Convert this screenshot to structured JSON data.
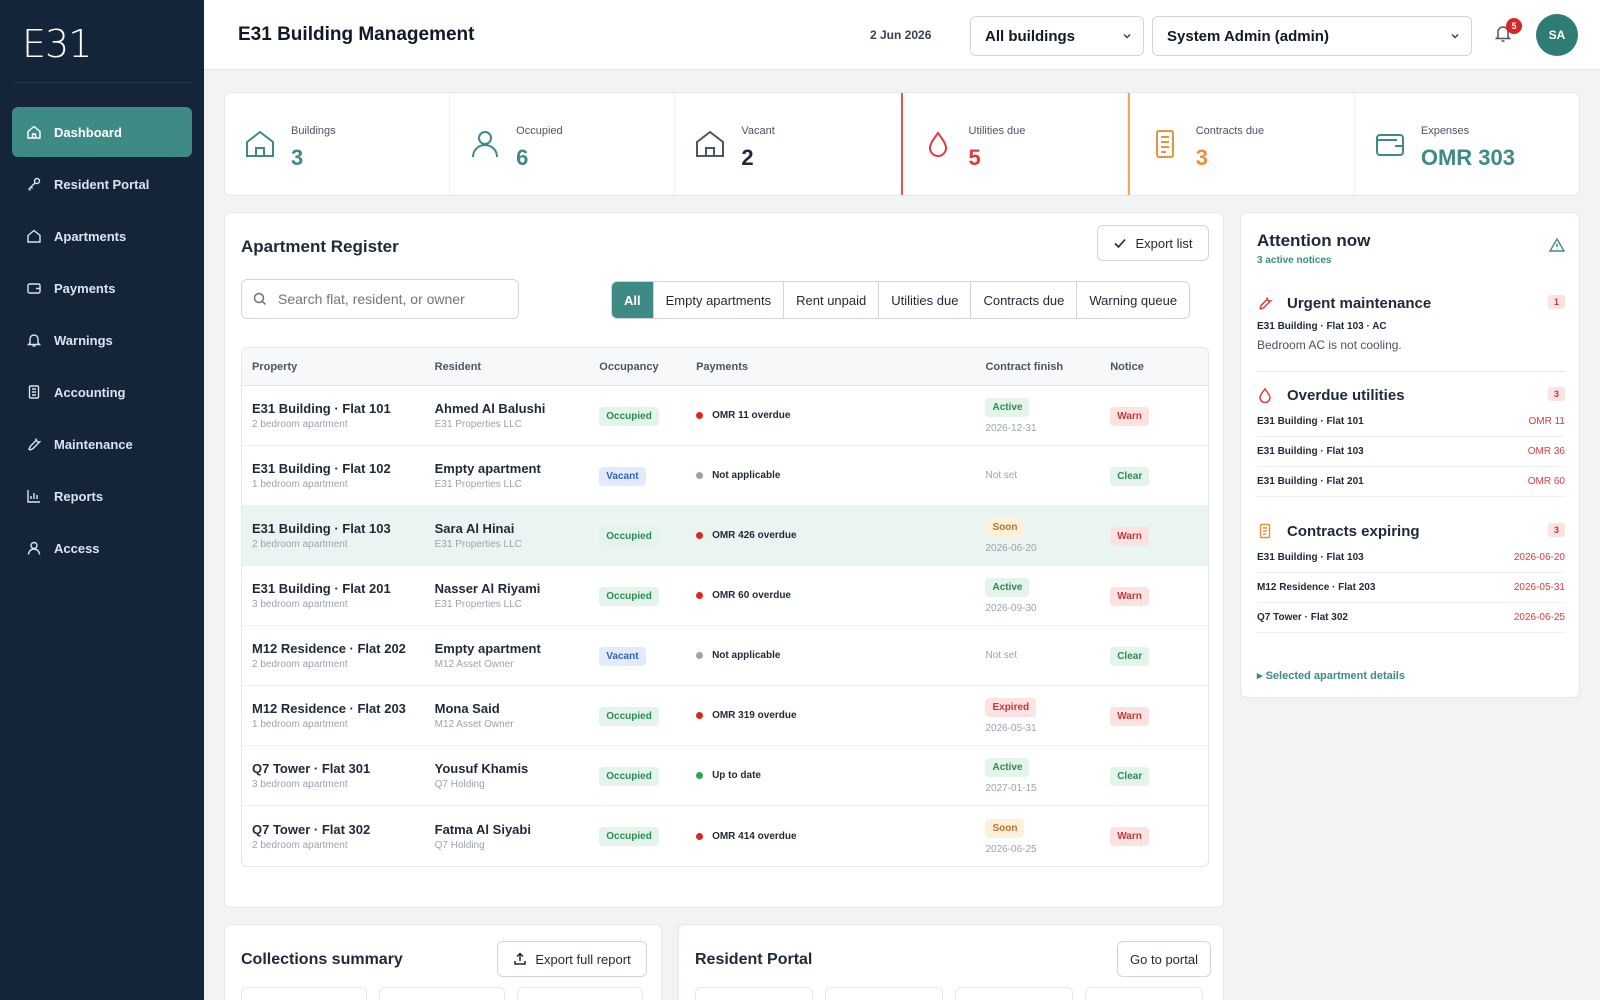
{
  "sidebar": {
    "logo": "E31",
    "items": [
      {
        "label": "Dashboard",
        "icon": "home-icon",
        "active": true
      },
      {
        "label": "Resident Portal",
        "icon": "key-icon"
      },
      {
        "label": "Apartments",
        "icon": "house-icon"
      },
      {
        "label": "Payments",
        "icon": "wallet-icon"
      },
      {
        "label": "Warnings",
        "icon": "bell-icon"
      },
      {
        "label": "Accounting",
        "icon": "ledger-icon"
      },
      {
        "label": "Maintenance",
        "icon": "wrench-icon"
      },
      {
        "label": "Reports",
        "icon": "bar-chart-icon"
      },
      {
        "label": "Access",
        "icon": "user-icon"
      }
    ]
  },
  "header": {
    "title": "E31 Building Management",
    "date": "2 Jun 2026",
    "building_select": "All buildings",
    "user_select": "System Admin (admin)",
    "notification_count": "5",
    "avatar_initials": "SA"
  },
  "stats": [
    {
      "label": "Buildings",
      "value": "3"
    },
    {
      "label": "Occupied",
      "value": "6"
    },
    {
      "label": "Vacant",
      "value": "2"
    },
    {
      "label": "Utilities due",
      "value": "5"
    },
    {
      "label": "Contracts due",
      "value": "3"
    },
    {
      "label": "Expenses",
      "value": "OMR 303"
    }
  ],
  "register": {
    "title": "Apartment Register",
    "export_label": "Export list",
    "search_placeholder": "Search flat, resident, or owner",
    "filters": [
      "All",
      "Empty apartments",
      "Rent unpaid",
      "Utilities due",
      "Contracts due",
      "Warning queue"
    ],
    "columns": [
      "Property",
      "Resident",
      "Occupancy",
      "Payments",
      "Contract finish",
      "Notice"
    ],
    "rows": [
      {
        "property": "E31 Building · Flat 101",
        "type": "2 bedroom apartment",
        "resident": "Ahmed Al Balushi",
        "owner": "E31 Properties LLC",
        "occupancy": "Occupied",
        "payment": "OMR 11 overdue",
        "pay_status": "red",
        "contract": "Active",
        "contract_date": "2026-12-31",
        "notice": "Warn"
      },
      {
        "property": "E31 Building · Flat 102",
        "type": "1 bedroom apartment",
        "resident": "Empty apartment",
        "owner": "E31 Properties LLC",
        "occupancy": "Vacant",
        "payment": "Not applicable",
        "pay_status": "grey",
        "contract": "",
        "contract_date": "Not set",
        "notice": "Clear"
      },
      {
        "property": "E31 Building · Flat 103",
        "type": "2 bedroom apartment",
        "resident": "Sara Al Hinai",
        "owner": "E31 Properties LLC",
        "occupancy": "Occupied",
        "payment": "OMR 426 overdue",
        "pay_status": "red",
        "contract": "Soon",
        "contract_date": "2026-06-20",
        "notice": "Warn"
      },
      {
        "property": "E31 Building · Flat 201",
        "type": "3 bedroom apartment",
        "resident": "Nasser Al Riyami",
        "owner": "E31 Properties LLC",
        "occupancy": "Occupied",
        "payment": "OMR 60 overdue",
        "pay_status": "red",
        "contract": "Active",
        "contract_date": "2026-09-30",
        "notice": "Warn"
      },
      {
        "property": "M12 Residence · Flat 202",
        "type": "2 bedroom apartment",
        "resident": "Empty apartment",
        "owner": "M12 Asset Owner",
        "occupancy": "Vacant",
        "payment": "Not applicable",
        "pay_status": "grey",
        "contract": "",
        "contract_date": "Not set",
        "notice": "Clear"
      },
      {
        "property": "M12 Residence · Flat 203",
        "type": "1 bedroom apartment",
        "resident": "Mona Said",
        "owner": "M12 Asset Owner",
        "occupancy": "Occupied",
        "payment": "OMR 319 overdue",
        "pay_status": "red",
        "contract": "Expired",
        "contract_date": "2026-05-31",
        "notice": "Warn"
      },
      {
        "property": "Q7 Tower · Flat 301",
        "type": "3 bedroom apartment",
        "resident": "Yousuf Khamis",
        "owner": "Q7 Holding",
        "occupancy": "Occupied",
        "payment": "Up to date",
        "pay_status": "green",
        "contract": "Active",
        "contract_date": "2027-01-15",
        "notice": "Clear"
      },
      {
        "property": "Q7 Tower · Flat 302",
        "type": "2 bedroom apartment",
        "resident": "Fatma Al Siyabi",
        "owner": "Q7 Holding",
        "occupancy": "Occupied",
        "payment": "OMR 414 overdue",
        "pay_status": "red",
        "contract": "Soon",
        "contract_date": "2026-06-25",
        "notice": "Warn"
      }
    ]
  },
  "attention": {
    "title": "Attention now",
    "subtitle": "3 active notices",
    "maintenance": {
      "title": "Urgent maintenance",
      "count": "1",
      "line1": "E31 Building · Flat 103 · AC",
      "line2": "Bedroom AC is not cooling."
    },
    "utilities": {
      "title": "Overdue utilities",
      "count": "3",
      "items": [
        {
          "name": "E31 Building · Flat 101",
          "amount": "OMR 11"
        },
        {
          "name": "E31 Building · Flat 103",
          "amount": "OMR 36"
        },
        {
          "name": "E31 Building · Flat 201",
          "amount": "OMR 60"
        }
      ]
    },
    "contracts": {
      "title": "Contracts expiring",
      "count": "3",
      "items": [
        {
          "name": "E31 Building · Flat 103",
          "amount": "2026-06-20"
        },
        {
          "name": "M12 Residence · Flat 203",
          "amount": "2026-05-31"
        },
        {
          "name": "Q7 Tower · Flat 302",
          "amount": "2026-06-25"
        }
      ]
    },
    "details_link": "▸ Selected apartment details"
  },
  "collections": {
    "title": "Collections summary",
    "export_label": "Export full report"
  },
  "portal": {
    "title": "Resident Portal",
    "button_label": "Go to portal"
  },
  "colors": {
    "accent": "#3d8b84",
    "sidebar": "#14253a",
    "danger": "#dc3c3c",
    "warning": "#e8923a"
  }
}
